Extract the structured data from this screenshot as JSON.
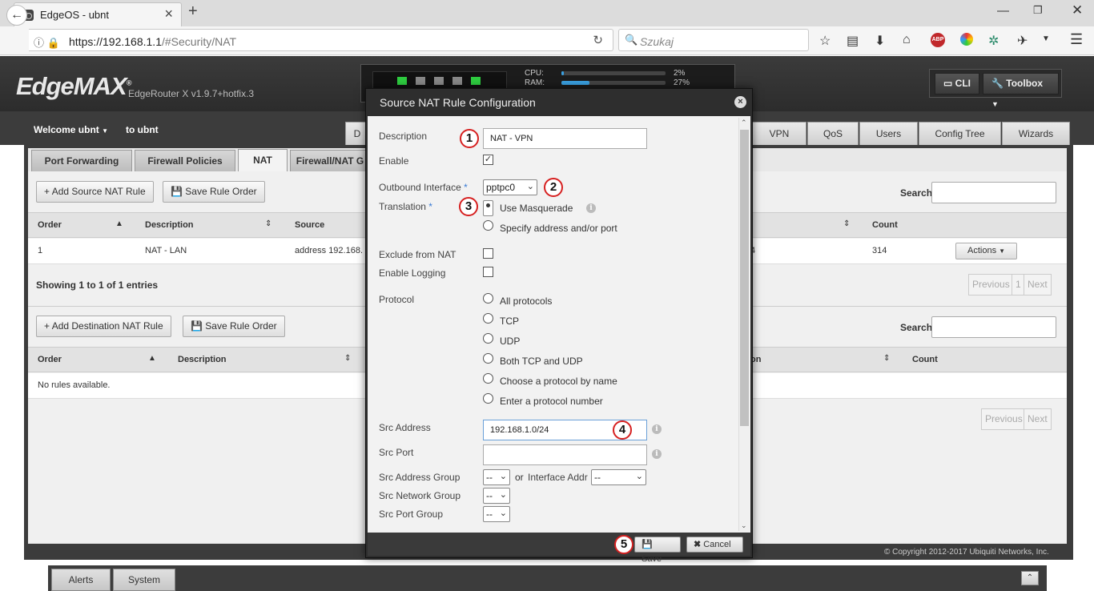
{
  "browser": {
    "tab_title": "EdgeOS - ubnt",
    "url_host": "https://192.168.1.1",
    "url_path": "/#Security/NAT",
    "search_placeholder": "Szukaj"
  },
  "header": {
    "logo": "EdgeMAX",
    "logo_mark": "®",
    "version": "EdgeRouter X v1.9.7+hotfix.3",
    "cpu_label": "CPU:",
    "cpu_value": "2%",
    "cpu_fraction": 0.02,
    "ram_label": "RAM:",
    "ram_value": "27%",
    "ram_fraction": 0.27,
    "cli_label": "CLI",
    "toolbox_label": "Toolbox"
  },
  "nav": {
    "welcome": "Welcome ubnt",
    "to_user": "to ubnt",
    "tab_d": "D",
    "tabs": [
      "VPN",
      "QoS",
      "Users",
      "Config Tree",
      "Wizards"
    ]
  },
  "subtabs": [
    "Port Forwarding",
    "Firewall Policies",
    "NAT",
    "Firewall/NAT G"
  ],
  "source_nat": {
    "add_button": "Add Source NAT Rule",
    "save_button": "Save Rule Order",
    "search_label": "Search",
    "columns": {
      "order": "Order",
      "description": "Description",
      "source": "Source",
      "count": "Count"
    },
    "rows": [
      {
        "order": "1",
        "description": "NAT - LAN",
        "source": "address 192.168.",
        "extra": "4",
        "count": "314",
        "actions": "Actions"
      }
    ],
    "showing": {
      "prefix": "Showing ",
      "from": "1",
      "to_word": " to ",
      "to": "1",
      "of_word": " of ",
      "total": "1",
      "suffix": " entries"
    },
    "pager": {
      "previous": "Previous",
      "page": "1",
      "next": "Next"
    }
  },
  "dest_nat": {
    "add_button": "Add Destination NAT Rule",
    "save_button": "Save Rule Order",
    "search_label": "Search",
    "columns": {
      "order": "Order",
      "description": "Description",
      "translation": "on",
      "count": "Count"
    },
    "empty": "No rules available.",
    "pager": {
      "previous": "Previous",
      "next": "Next"
    }
  },
  "footer": {
    "copyright": "© Copyright 2012-2017 Ubiquiti Networks, Inc.",
    "alerts": "Alerts",
    "system": "System"
  },
  "modal": {
    "title": "Source NAT Rule Configuration",
    "description_label": "Description",
    "description_value": "NAT - VPN",
    "enable_label": "Enable",
    "enable_checked": true,
    "outbound_label": "Outbound Interface",
    "outbound_value": "pptpc0",
    "translation_label": "Translation",
    "translation_options": [
      "Use Masquerade",
      "Specify address and/or port"
    ],
    "translation_selected": "Use Masquerade",
    "exclude_label": "Exclude from NAT",
    "logging_label": "Enable Logging",
    "protocol_label": "Protocol",
    "protocol_options": [
      "All protocols",
      "TCP",
      "UDP",
      "Both TCP and UDP",
      "Choose a protocol by name",
      "Enter a protocol number"
    ],
    "src_address_label": "Src Address",
    "src_address_value": "192.168.1.0/24",
    "src_port_label": "Src Port",
    "src_port_value": "",
    "src_address_group_label": "Src Address Group",
    "src_address_group_value": "--",
    "or_label": "or",
    "interface_addr_label": "Interface Addr",
    "interface_addr_value": "--",
    "src_network_group_label": "Src Network Group",
    "src_network_group_value": "--",
    "src_port_group_label": "Src Port Group",
    "src_port_group_value": "--",
    "save_label": "Save",
    "cancel_label": "Cancel",
    "required_mark": "*"
  },
  "callouts": [
    "1",
    "2",
    "3",
    "4",
    "5"
  ],
  "colors": {
    "accent": "#3aa0e0",
    "callout_border": "#d62020",
    "port_on": "#2ecc40"
  }
}
